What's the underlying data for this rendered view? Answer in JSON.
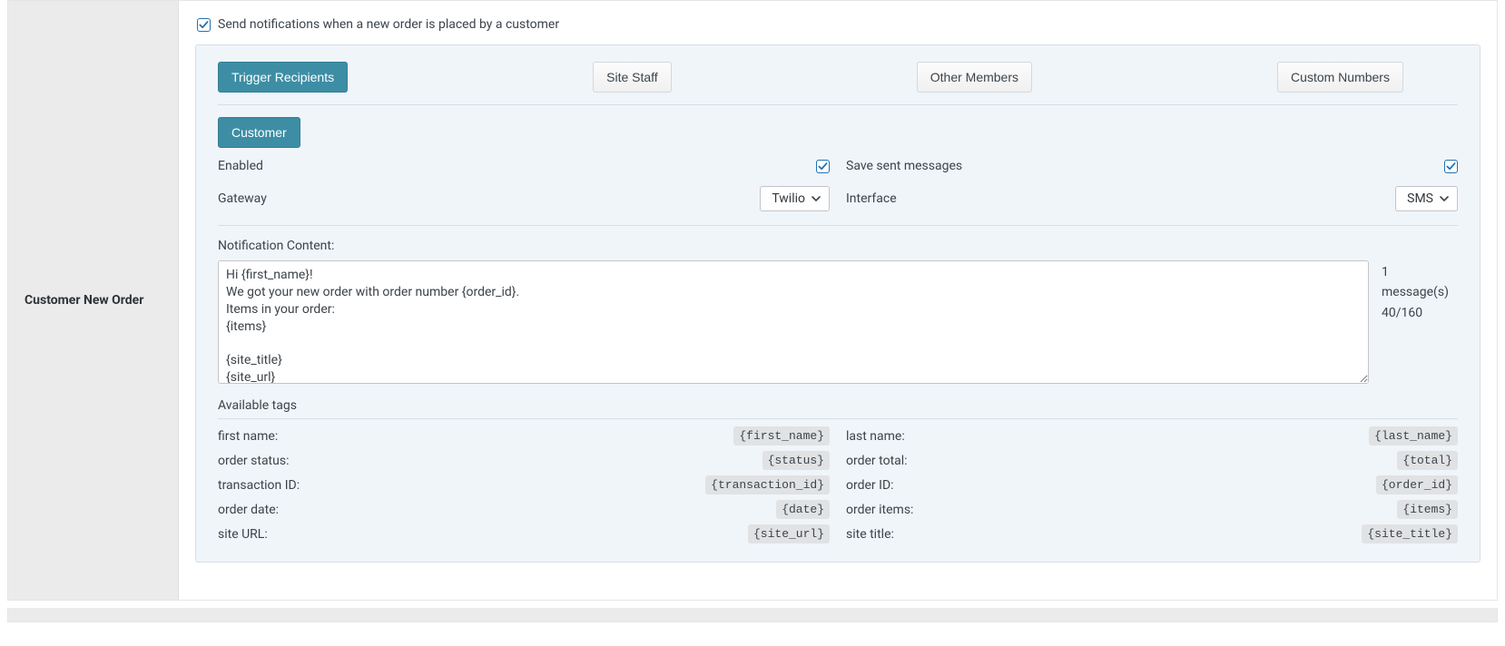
{
  "sidebar": {
    "title": "Customer New Order"
  },
  "top": {
    "send_notifications_label": "Send notifications when a new order is placed by a customer"
  },
  "tabs": {
    "trigger_recipients": "Trigger Recipients",
    "site_staff": "Site Staff",
    "other_members": "Other Members",
    "custom_numbers": "Custom Numbers"
  },
  "subtabs": {
    "customer": "Customer"
  },
  "settings": {
    "enabled_label": "Enabled",
    "save_sent_label": "Save sent messages",
    "gateway_label": "Gateway",
    "gateway_value": "Twilio",
    "interface_label": "Interface",
    "interface_value": "SMS"
  },
  "content": {
    "label": "Notification Content:",
    "value": "Hi {first_name}!\nWe got your new order with order number {order_id}.\nItems in your order:\n{items}\n\n{site_title}\n{site_url}",
    "message_count": "1 message(s)",
    "char_count": "40/160"
  },
  "tags": {
    "header": "Available tags",
    "items": {
      "first_name": {
        "label": "first name:",
        "code": "{first_name}"
      },
      "last_name": {
        "label": "last name:",
        "code": "{last_name}"
      },
      "order_status": {
        "label": "order status:",
        "code": "{status}"
      },
      "order_total": {
        "label": "order total:",
        "code": "{total}"
      },
      "transaction_id": {
        "label": "transaction ID:",
        "code": "{transaction_id}"
      },
      "order_id": {
        "label": "order ID:",
        "code": "{order_id}"
      },
      "order_date": {
        "label": "order date:",
        "code": "{date}"
      },
      "order_items": {
        "label": "order items:",
        "code": "{items}"
      },
      "site_url": {
        "label": "site URL:",
        "code": "{site_url}"
      },
      "site_title": {
        "label": "site title:",
        "code": "{site_title}"
      }
    }
  }
}
